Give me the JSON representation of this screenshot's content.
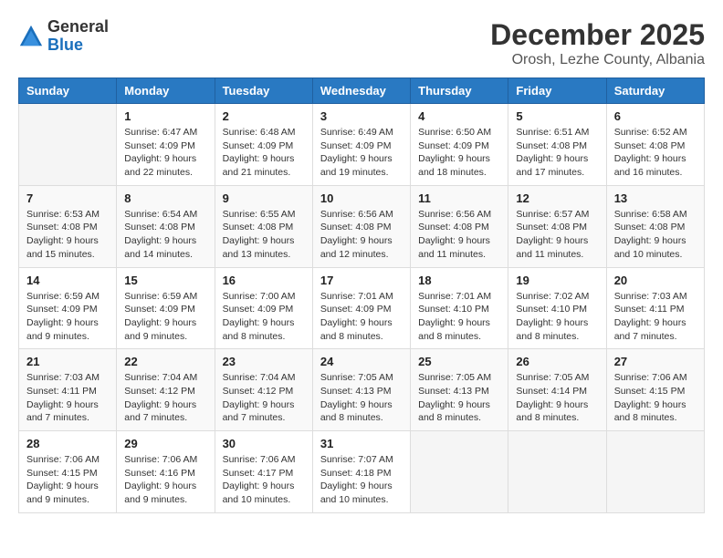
{
  "logo": {
    "general": "General",
    "blue": "Blue"
  },
  "title": "December 2025",
  "subtitle": "Orosh, Lezhe County, Albania",
  "days_header": [
    "Sunday",
    "Monday",
    "Tuesday",
    "Wednesday",
    "Thursday",
    "Friday",
    "Saturday"
  ],
  "weeks": [
    [
      {
        "day": "",
        "info": ""
      },
      {
        "day": "1",
        "info": "Sunrise: 6:47 AM\nSunset: 4:09 PM\nDaylight: 9 hours\nand 22 minutes."
      },
      {
        "day": "2",
        "info": "Sunrise: 6:48 AM\nSunset: 4:09 PM\nDaylight: 9 hours\nand 21 minutes."
      },
      {
        "day": "3",
        "info": "Sunrise: 6:49 AM\nSunset: 4:09 PM\nDaylight: 9 hours\nand 19 minutes."
      },
      {
        "day": "4",
        "info": "Sunrise: 6:50 AM\nSunset: 4:09 PM\nDaylight: 9 hours\nand 18 minutes."
      },
      {
        "day": "5",
        "info": "Sunrise: 6:51 AM\nSunset: 4:08 PM\nDaylight: 9 hours\nand 17 minutes."
      },
      {
        "day": "6",
        "info": "Sunrise: 6:52 AM\nSunset: 4:08 PM\nDaylight: 9 hours\nand 16 minutes."
      }
    ],
    [
      {
        "day": "7",
        "info": "Sunrise: 6:53 AM\nSunset: 4:08 PM\nDaylight: 9 hours\nand 15 minutes."
      },
      {
        "day": "8",
        "info": "Sunrise: 6:54 AM\nSunset: 4:08 PM\nDaylight: 9 hours\nand 14 minutes."
      },
      {
        "day": "9",
        "info": "Sunrise: 6:55 AM\nSunset: 4:08 PM\nDaylight: 9 hours\nand 13 minutes."
      },
      {
        "day": "10",
        "info": "Sunrise: 6:56 AM\nSunset: 4:08 PM\nDaylight: 9 hours\nand 12 minutes."
      },
      {
        "day": "11",
        "info": "Sunrise: 6:56 AM\nSunset: 4:08 PM\nDaylight: 9 hours\nand 11 minutes."
      },
      {
        "day": "12",
        "info": "Sunrise: 6:57 AM\nSunset: 4:08 PM\nDaylight: 9 hours\nand 11 minutes."
      },
      {
        "day": "13",
        "info": "Sunrise: 6:58 AM\nSunset: 4:08 PM\nDaylight: 9 hours\nand 10 minutes."
      }
    ],
    [
      {
        "day": "14",
        "info": "Sunrise: 6:59 AM\nSunset: 4:09 PM\nDaylight: 9 hours\nand 9 minutes."
      },
      {
        "day": "15",
        "info": "Sunrise: 6:59 AM\nSunset: 4:09 PM\nDaylight: 9 hours\nand 9 minutes."
      },
      {
        "day": "16",
        "info": "Sunrise: 7:00 AM\nSunset: 4:09 PM\nDaylight: 9 hours\nand 8 minutes."
      },
      {
        "day": "17",
        "info": "Sunrise: 7:01 AM\nSunset: 4:09 PM\nDaylight: 9 hours\nand 8 minutes."
      },
      {
        "day": "18",
        "info": "Sunrise: 7:01 AM\nSunset: 4:10 PM\nDaylight: 9 hours\nand 8 minutes."
      },
      {
        "day": "19",
        "info": "Sunrise: 7:02 AM\nSunset: 4:10 PM\nDaylight: 9 hours\nand 8 minutes."
      },
      {
        "day": "20",
        "info": "Sunrise: 7:03 AM\nSunset: 4:11 PM\nDaylight: 9 hours\nand 7 minutes."
      }
    ],
    [
      {
        "day": "21",
        "info": "Sunrise: 7:03 AM\nSunset: 4:11 PM\nDaylight: 9 hours\nand 7 minutes."
      },
      {
        "day": "22",
        "info": "Sunrise: 7:04 AM\nSunset: 4:12 PM\nDaylight: 9 hours\nand 7 minutes."
      },
      {
        "day": "23",
        "info": "Sunrise: 7:04 AM\nSunset: 4:12 PM\nDaylight: 9 hours\nand 7 minutes."
      },
      {
        "day": "24",
        "info": "Sunrise: 7:05 AM\nSunset: 4:13 PM\nDaylight: 9 hours\nand 8 minutes."
      },
      {
        "day": "25",
        "info": "Sunrise: 7:05 AM\nSunset: 4:13 PM\nDaylight: 9 hours\nand 8 minutes."
      },
      {
        "day": "26",
        "info": "Sunrise: 7:05 AM\nSunset: 4:14 PM\nDaylight: 9 hours\nand 8 minutes."
      },
      {
        "day": "27",
        "info": "Sunrise: 7:06 AM\nSunset: 4:15 PM\nDaylight: 9 hours\nand 8 minutes."
      }
    ],
    [
      {
        "day": "28",
        "info": "Sunrise: 7:06 AM\nSunset: 4:15 PM\nDaylight: 9 hours\nand 9 minutes."
      },
      {
        "day": "29",
        "info": "Sunrise: 7:06 AM\nSunset: 4:16 PM\nDaylight: 9 hours\nand 9 minutes."
      },
      {
        "day": "30",
        "info": "Sunrise: 7:06 AM\nSunset: 4:17 PM\nDaylight: 9 hours\nand 10 minutes."
      },
      {
        "day": "31",
        "info": "Sunrise: 7:07 AM\nSunset: 4:18 PM\nDaylight: 9 hours\nand 10 minutes."
      },
      {
        "day": "",
        "info": ""
      },
      {
        "day": "",
        "info": ""
      },
      {
        "day": "",
        "info": ""
      }
    ]
  ]
}
